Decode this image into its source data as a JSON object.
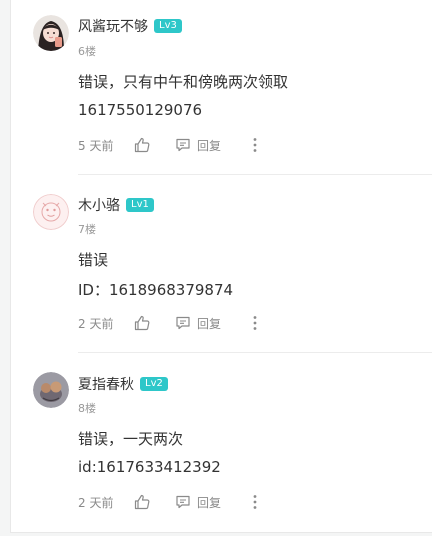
{
  "comments": [
    {
      "username": "风酱玩不够",
      "level": "Lv3",
      "floor": "6楼",
      "lines": [
        "错误，只有中午和傍晚两次领取",
        "1617550129076"
      ],
      "time": "5 天前",
      "reply_label": "回复"
    },
    {
      "username": "木小骆",
      "level": "Lv1",
      "floor": "7楼",
      "lines": [
        "错误",
        "ID：1618968379874"
      ],
      "time": "2 天前",
      "reply_label": "回复"
    },
    {
      "username": "夏指春秋",
      "level": "Lv2",
      "floor": "8楼",
      "lines": [
        "错误，一天两次",
        "id:1617633412392"
      ],
      "time": "2 天前",
      "reply_label": "回复"
    }
  ],
  "colors": {
    "level_badge": "#2ec7c9",
    "muted": "#8a8a8a",
    "text": "#333333"
  }
}
